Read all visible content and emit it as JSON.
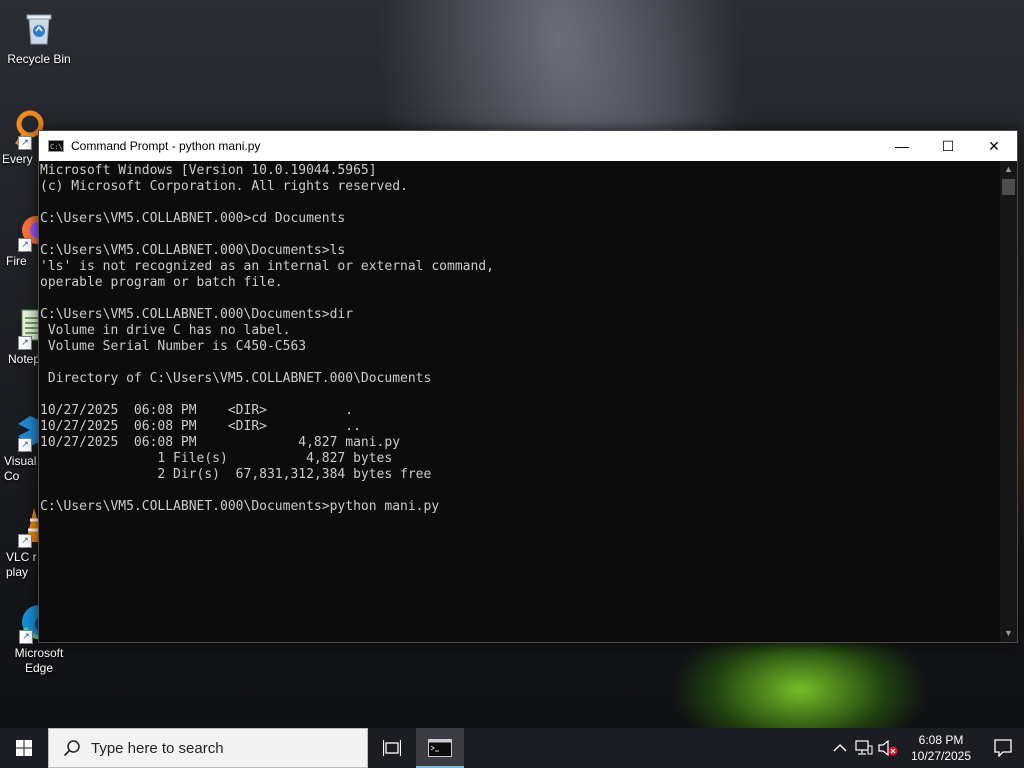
{
  "desktop": {
    "icons": [
      {
        "label": "Recycle Bin"
      },
      {
        "label": "Every"
      },
      {
        "label": "Fire"
      },
      {
        "label": "Notep"
      },
      {
        "label": "Visual\nCo"
      },
      {
        "label": "VLC r\nplay"
      },
      {
        "label": "Microsoft\nEdge"
      }
    ]
  },
  "window": {
    "title": "Command Prompt - python  mani.py",
    "icon_label": "C:\\",
    "controls": {
      "minimize": "—",
      "maximize": "☐",
      "close": "✕"
    },
    "console_lines": [
      "Microsoft Windows [Version 10.0.19044.5965]",
      "(c) Microsoft Corporation. All rights reserved.",
      "",
      "C:\\Users\\VM5.COLLABNET.000>cd Documents",
      "",
      "C:\\Users\\VM5.COLLABNET.000\\Documents>ls",
      "'ls' is not recognized as an internal or external command,",
      "operable program or batch file.",
      "",
      "C:\\Users\\VM5.COLLABNET.000\\Documents>dir",
      " Volume in drive C has no label.",
      " Volume Serial Number is C450-C563",
      "",
      " Directory of C:\\Users\\VM5.COLLABNET.000\\Documents",
      "",
      "10/27/2025  06:08 PM    <DIR>          .",
      "10/27/2025  06:08 PM    <DIR>          ..",
      "10/27/2025  06:08 PM             4,827 mani.py",
      "               1 File(s)          4,827 bytes",
      "               2 Dir(s)  67,831,312,384 bytes free",
      "",
      "C:\\Users\\VM5.COLLABNET.000\\Documents>python mani.py"
    ]
  },
  "taskbar": {
    "search_placeholder": "Type here to search",
    "clock_time": "6:08 PM",
    "clock_date": "10/27/2025"
  },
  "colors": {
    "console_bg": "#0c0c0c",
    "console_fg": "#cccccc",
    "taskbar_bg": "#1b1d22",
    "accent": "#76b9ed"
  }
}
